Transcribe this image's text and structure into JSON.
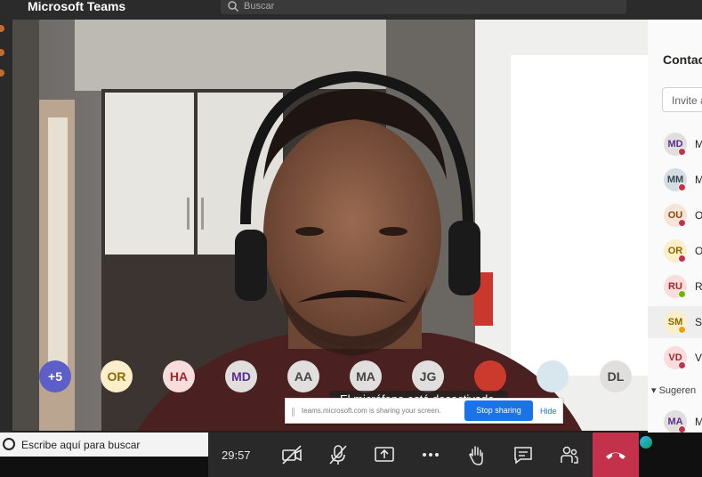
{
  "app": {
    "title": "Microsoft Teams",
    "search_placeholder": "Buscar"
  },
  "panel": {
    "title": "Contactos",
    "invite_placeholder": "Invite a",
    "people": [
      {
        "initials": "MD",
        "name": "M",
        "bg": "#e1dfdd",
        "fg": "#5c2e91",
        "status": "#c4314b"
      },
      {
        "initials": "MM",
        "name": "M",
        "bg": "#d5dde4",
        "fg": "#37474f",
        "status": "#c4314b"
      },
      {
        "initials": "OU",
        "name": "O",
        "bg": "#f6e5d6",
        "fg": "#8a4a16",
        "status": "#c4314b"
      },
      {
        "initials": "OR",
        "name": "O",
        "bg": "#fbeecb",
        "fg": "#8a6a00",
        "status": "#c4314b"
      },
      {
        "initials": "RU",
        "name": "R",
        "bg": "#f9dcdc",
        "fg": "#a4262c",
        "status": "#6bb700"
      },
      {
        "initials": "SM",
        "name": "S",
        "bg": "#fbeecb",
        "fg": "#8a6a00",
        "status": "#eaa300"
      },
      {
        "initials": "VD",
        "name": "V",
        "bg": "#f9dcdc",
        "fg": "#a4262c",
        "status": "#c4314b"
      }
    ],
    "suggestions_label": "Sugeren",
    "suggestion": {
      "initials": "MA",
      "name": "M",
      "bg": "#e1dfdd",
      "fg": "#5c2e91",
      "status": "#c4314b"
    }
  },
  "participants": [
    {
      "label": "+5",
      "bg": "#5b5fc7",
      "fg": "#ffffff"
    },
    {
      "label": "OR",
      "bg": "#fbeecb",
      "fg": "#8a6a00"
    },
    {
      "label": "HA",
      "bg": "#f9dcdc",
      "fg": "#a4262c"
    },
    {
      "label": "MD",
      "bg": "#e1dfdd",
      "fg": "#5c2e91"
    },
    {
      "label": "AA",
      "bg": "#e1dfdd",
      "fg": "#444444"
    },
    {
      "label": "MA",
      "bg": "#e1dfdd",
      "fg": "#444444"
    },
    {
      "label": "JG",
      "bg": "#e1dfdd",
      "fg": "#444444"
    },
    {
      "label": "",
      "bg": "#cc3a2e",
      "fg": "#ffffff"
    },
    {
      "label": "",
      "bg": "#d8e6ee",
      "fg": "#ffffff"
    },
    {
      "label": "DL",
      "bg": "#e1dfdd",
      "fg": "#444444"
    }
  ],
  "toast": {
    "mic_muted": "El micrófono está desactivado."
  },
  "share_bar": {
    "message": "teams.microsoft.com is sharing your screen.",
    "stop_label": "Stop sharing",
    "hide_label": "Hide"
  },
  "taskbar": {
    "search_placeholder": "Escribe aquí para buscar"
  },
  "controls": {
    "timer": "29:57",
    "buttons": [
      "camera-off",
      "mic-off",
      "share-screen",
      "more",
      "raise-hand",
      "chat",
      "participants"
    ]
  },
  "colors": {
    "hangup": "#c4314b",
    "accent": "#5b5fc7"
  }
}
